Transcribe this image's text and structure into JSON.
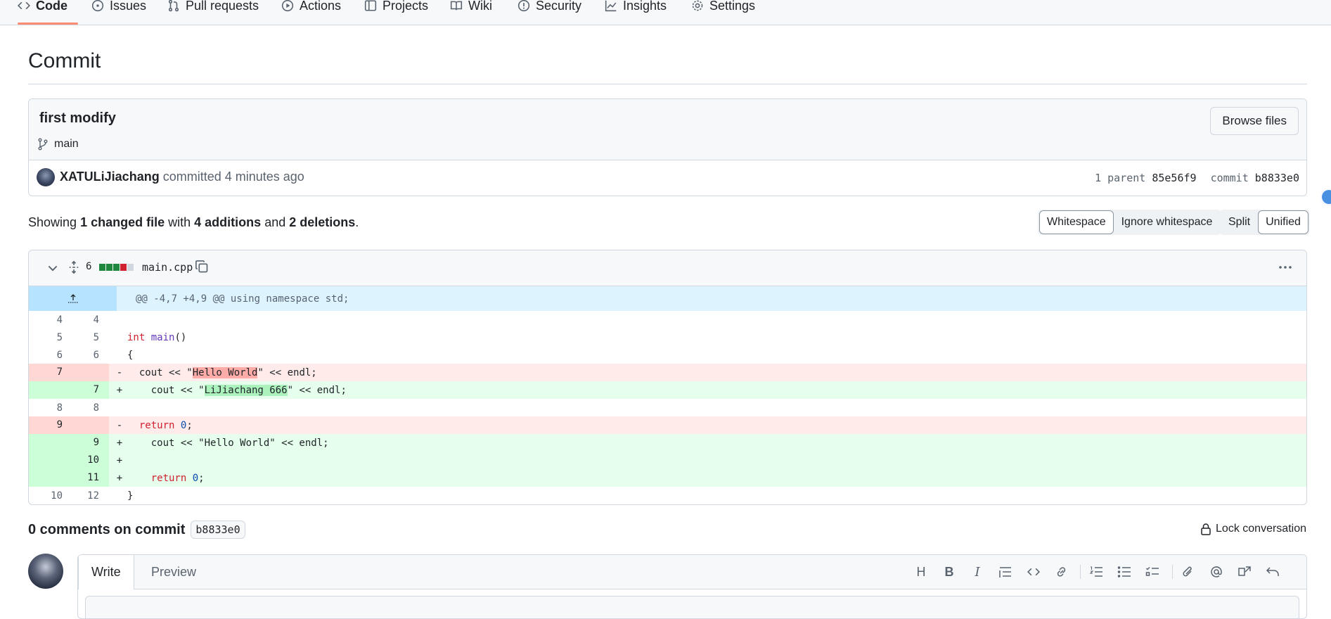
{
  "nav": {
    "tabs": [
      {
        "label": "Code",
        "icon": "code-icon"
      },
      {
        "label": "Issues",
        "icon": "issue-icon"
      },
      {
        "label": "Pull requests",
        "icon": "pull-request-icon"
      },
      {
        "label": "Actions",
        "icon": "play-icon"
      },
      {
        "label": "Projects",
        "icon": "table-icon"
      },
      {
        "label": "Wiki",
        "icon": "book-icon"
      },
      {
        "label": "Security",
        "icon": "shield-icon"
      },
      {
        "label": "Insights",
        "icon": "graph-icon"
      },
      {
        "label": "Settings",
        "icon": "gear-icon"
      }
    ]
  },
  "page": {
    "title": "Commit"
  },
  "commit": {
    "message": "first modify",
    "branch": "main",
    "browse_label": "Browse files",
    "author": "XATULiJiachang",
    "action_text": "committed 4 minutes ago",
    "parent_label": "1 parent",
    "parent_sha": "85e56f9",
    "commit_label": "commit",
    "commit_sha": "b8833e0"
  },
  "summary": {
    "prefix": "Showing",
    "changed": "1 changed file",
    "with": "with",
    "additions": "4 additions",
    "and": "and",
    "deletions": "2 deletions",
    "suffix": "."
  },
  "view_options": {
    "whitespace": "Whitespace",
    "ignore_whitespace": "Ignore whitespace",
    "split": "Split",
    "unified": "Unified"
  },
  "file": {
    "changes": "6",
    "name": "main.cpp",
    "diffstat": [
      "add",
      "add",
      "add",
      "del",
      "neutral"
    ],
    "colors": {
      "add": "#1f883d",
      "del": "#cf222e",
      "neutral": "#d0d7de"
    },
    "hunk_header": "@@ -4,7 +4,9 @@ using namespace std;"
  },
  "diff_lines": [
    {
      "old": "4",
      "new": "4",
      "sign": "",
      "type": "ctx"
    },
    {
      "old": "5",
      "new": "5",
      "sign": "",
      "type": "ctx"
    },
    {
      "old": "6",
      "new": "6",
      "sign": "",
      "type": "ctx"
    },
    {
      "old": "7",
      "new": "",
      "sign": "-",
      "type": "del"
    },
    {
      "old": "",
      "new": "7",
      "sign": "+",
      "type": "add"
    },
    {
      "old": "8",
      "new": "8",
      "sign": "",
      "type": "ctx"
    },
    {
      "old": "9",
      "new": "",
      "sign": "-",
      "type": "del"
    },
    {
      "old": "",
      "new": "9",
      "sign": "+",
      "type": "add"
    },
    {
      "old": "",
      "new": "10",
      "sign": "+",
      "type": "add"
    },
    {
      "old": "",
      "new": "11",
      "sign": "+",
      "type": "add"
    },
    {
      "old": "10",
      "new": "12",
      "sign": "",
      "type": "ctx"
    }
  ],
  "code": {
    "l5_kw": "int",
    "l5_fn": "main",
    "l5_rest": "()",
    "l6": "{",
    "l7_pre": "  cout << \"",
    "l7_hl": "Hello World",
    "l7_post": "\" << endl;",
    "l7n_pre": "    cout << \"",
    "l7n_hl": "LiJiachang 666",
    "l7n_post": "\" << endl;",
    "l9_kw": "return",
    "l9_num": "0",
    "l9_post": ";",
    "l9n": "    cout << \"Hello World\" << endl;",
    "l11_kw": "return",
    "l11_num": "0",
    "l11_post": ";",
    "l12": "}"
  },
  "comments": {
    "count_text": "0 comments on commit",
    "sha": "b8833e0",
    "lock_label": "Lock conversation",
    "tab_write": "Write",
    "tab_preview": "Preview",
    "toolbar": [
      "H",
      "B",
      "I",
      "quote-icon",
      "code-icon",
      "link-icon",
      "numbered-list-icon",
      "bullet-list-icon",
      "task-list-icon",
      "attach-icon",
      "mention-icon",
      "cross-reference-icon",
      "undo-icon"
    ]
  }
}
